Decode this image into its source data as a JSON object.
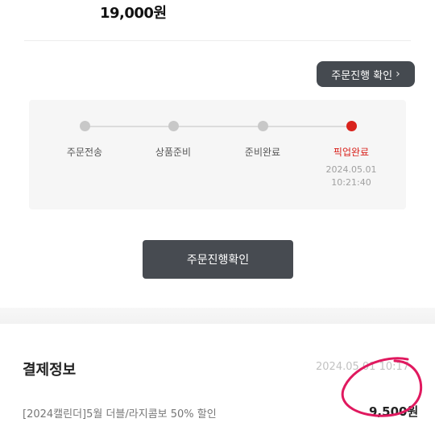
{
  "summary": {
    "total_price": "19,000원"
  },
  "header_action": {
    "label": "주문진행 확인",
    "chevron": "›"
  },
  "progress": {
    "steps": [
      {
        "label": "주문전송",
        "state": "done"
      },
      {
        "label": "상품준비",
        "state": "done"
      },
      {
        "label": "준비완료",
        "state": "done"
      },
      {
        "label": "픽업완료",
        "state": "current",
        "date": "2024.05.01",
        "time": "10:21:40"
      }
    ]
  },
  "confirm_button": {
    "label": "주문진행확인"
  },
  "payment": {
    "title": "결제정보",
    "date": "2024.05.01 10:17",
    "item_name": "[2024캘린더]5월 더블/라지콤보 50% 할인",
    "item_price": "9,500원"
  },
  "colors": {
    "accent_red": "#d9231d",
    "dark_button": "#474b51",
    "inactive_dot": "#c8c8c8"
  }
}
